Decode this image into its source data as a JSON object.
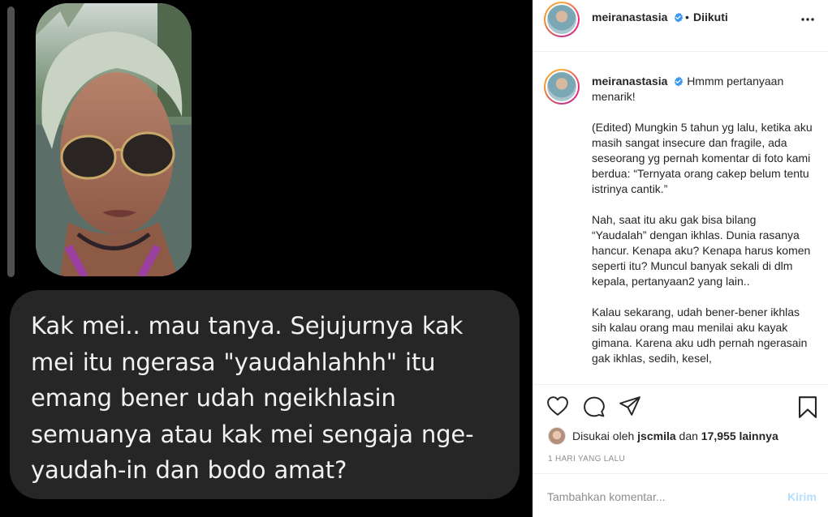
{
  "media": {
    "question_text": "Kak mei.. mau tanya. Sejujurnya kak mei itu ngerasa \"yaudahlahhh\" itu emang bener udah ngeikhlasin semuanya atau kak mei sengaja nge-yaudah-in dan bodo amat?"
  },
  "header": {
    "username": "meiranastasia",
    "separator": "•",
    "follow_status": "Diikuti",
    "more_icon": "more-horizontal-icon"
  },
  "caption": {
    "username": "meiranastasia",
    "paragraphs": [
      "Hmmm pertanyaan menarik!",
      "(Edited) Mungkin 5 tahun yg lalu, ketika aku masih sangat insecure dan fragile, ada seseorang yg pernah komentar di foto kami berdua: “Ternyata orang cakep belum tentu istrinya cantik.”",
      "Nah, saat itu aku gak bisa bilang “Yaudalah” dengan ikhlas. Dunia rasanya hancur. Kenapa aku? Kenapa harus komen seperti itu? Muncul banyak sekali di dlm kepala, pertanyaan2 yang lain..",
      "Kalau sekarang, udah bener-bener ikhlas sih kalau orang mau menilai aku kayak gimana. Karena aku udh pernah ngerasain gak ikhlas, sedih, kesel,"
    ]
  },
  "actions": {
    "icons": [
      "heart-icon",
      "comment-icon",
      "share-icon",
      "bookmark-icon"
    ]
  },
  "likes": {
    "prefix": "Disukai oleh",
    "user": "jscmila",
    "middle": "dan",
    "count": "17,955 lainnya"
  },
  "timestamp": "1 HARI YANG LALU",
  "comment": {
    "placeholder": "Tambahkan komentar...",
    "post_label": "Kirim"
  },
  "colors": {
    "verified_blue": "#3897f0",
    "post_button_disabled": "#b2dffc",
    "bubble_bg": "#262626"
  }
}
